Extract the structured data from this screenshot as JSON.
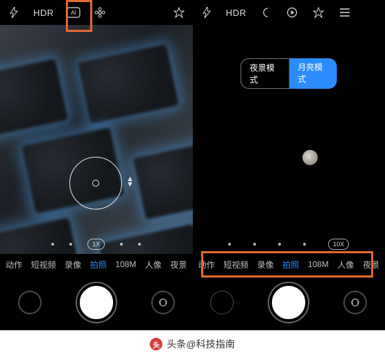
{
  "left": {
    "top": {
      "hdr": "HDR",
      "flash_icon": "flash-icon",
      "ai_icon": "ai-icon",
      "flower_icon": "flower-icon",
      "filter_icon": "filter-icon"
    },
    "zoom_chip": "1X",
    "modes": [
      "动作",
      "短视频",
      "录像",
      "拍照",
      "108M",
      "人像",
      "夜景"
    ],
    "active_mode_index": 3
  },
  "right": {
    "top": {
      "hdr": "HDR",
      "flash_icon": "flash-icon",
      "moon_icon": "moon-icon",
      "play_icon": "play-icon",
      "filter_icon": "filter-icon",
      "menu_icon": "menu-icon"
    },
    "pills": {
      "outline": "夜景模式",
      "fill": "月亮模式"
    },
    "zoom_chip": "10X",
    "modes": [
      "动作",
      "短视频",
      "录像",
      "拍照",
      "108M",
      "人像",
      "夜景"
    ],
    "active_mode_index": 3
  },
  "footer": {
    "logo": "头",
    "text": "头条@科技指南"
  },
  "colors": {
    "accent": "#2b8cff",
    "highlight": "#e46a2f"
  }
}
